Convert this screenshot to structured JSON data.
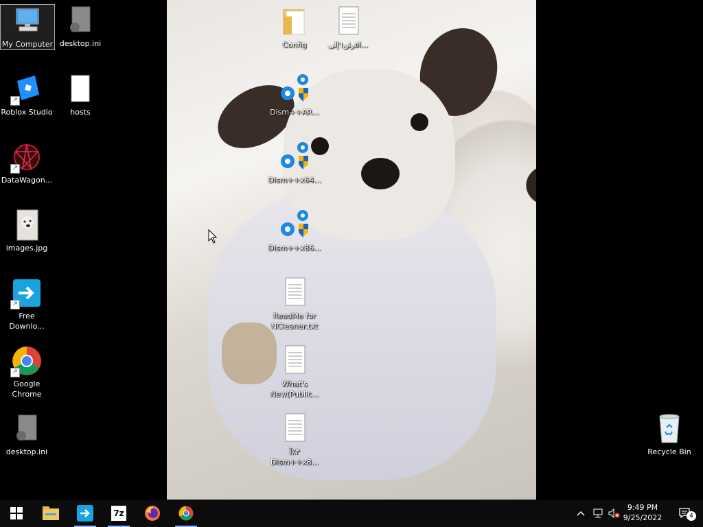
{
  "desktop_icons_left": [
    {
      "label": "My Computer"
    },
    {
      "label": "desktop.ini"
    },
    {
      "label": "Roblox Studio"
    },
    {
      "label": "hosts"
    },
    {
      "label": "DataWagon..."
    },
    {
      "label": "images.jpg"
    },
    {
      "label": "Free Downlo..."
    },
    {
      "label": "Google Chrome"
    },
    {
      "label": "desktop.ini"
    }
  ],
  "desktop_icons_middle": [
    {
      "label": "Config"
    },
    {
      "label": "ﺍ٥ﺮﺋﻦ٦ﺇﻟﻰ..."
    },
    {
      "label": "Dism++AR..."
    },
    {
      "label": "Dism++x64..."
    },
    {
      "label": "Dism++x86..."
    },
    {
      "label": "ReadMe for NCleaner.txt"
    },
    {
      "label": "What's New(Public..."
    },
    {
      "label": "٣٪ﺁ Dism++x8..."
    }
  ],
  "recycle_bin": {
    "label": "Recycle Bin"
  },
  "taskbar": {
    "start_icon": "windows-logo-icon",
    "pinned": [
      "file-explorer-icon",
      "free-download-manager-icon",
      "7zip-icon",
      "firefox-icon",
      "chrome-icon"
    ],
    "seven_zip_text": "7z",
    "clock": {
      "time": "9:49 PM",
      "date": "9/25/2022"
    },
    "notification_count": "4"
  },
  "colors": {
    "taskbar_bg": "#0c0c0c",
    "accent": "#8ab4f8"
  }
}
